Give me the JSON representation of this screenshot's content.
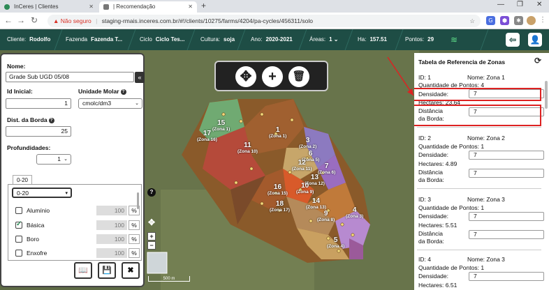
{
  "browser": {
    "tabs": [
      {
        "title": "InCeres | Clientes",
        "active": false
      },
      {
        "title": "| Recomendação",
        "active": true
      }
    ],
    "security_label": "Não seguro",
    "url": "staging-rmais.inceres.com.br/#!/clients/10275/farms/4204/pa-cycles/456311/solo"
  },
  "header": {
    "cliente_label": "Cliente:",
    "cliente_value": "Rodolfo",
    "fazenda_label": "Fazenda",
    "fazenda_value": "Fazenda T...",
    "ciclo_label": "Ciclo",
    "ciclo_value": "Ciclo Tes...",
    "cultura_label": "Cultura:",
    "cultura_value": "soja",
    "ano_label": "Ano:",
    "ano_value": "2020-2021",
    "areas_label": "Áreas:",
    "areas_value": "1",
    "ha_label": "Ha:",
    "ha_value": "157.51",
    "pontos_label": "Pontos:",
    "pontos_value": "29"
  },
  "left_panel": {
    "nome_label": "Nome:",
    "nome_value": "Grade Sub UGD 05/08",
    "id_inicial_label": "Id Inicial:",
    "id_inicial_value": "1",
    "unidade_label": "Unidade Molar",
    "unidade_value": "cmolc/dm3",
    "dist_borda_label": "Dist. da Borda",
    "dist_borda_value": "25",
    "profundidades_label": "Profundidades:",
    "profundidades_value": "1",
    "depth_tab": "0-20",
    "depth_select": "0-20",
    "elements": [
      {
        "name": "Alumínio",
        "checked": false,
        "value": "100",
        "unit": "%"
      },
      {
        "name": "Básica",
        "checked": true,
        "value": "100",
        "unit": "%"
      },
      {
        "name": "Boro",
        "checked": false,
        "value": "100",
        "unit": "%"
      },
      {
        "name": "Enxofre",
        "checked": false,
        "value": "100",
        "unit": "%"
      }
    ]
  },
  "map": {
    "scale_label": "500 m",
    "zones": [
      {
        "n": "15",
        "s": "(Zona 1)"
      },
      {
        "n": "17",
        "s": "(Zona 16)"
      },
      {
        "n": "1",
        "s": "(Zona 1)"
      },
      {
        "n": "11",
        "s": "(Zona 10)"
      },
      {
        "n": "3",
        "s": "(Zona 2)"
      },
      {
        "n": "6",
        "s": "(Zona 5)"
      },
      {
        "n": "12",
        "s": "(Zona 11)"
      },
      {
        "n": "7",
        "s": "(Zona 6)"
      },
      {
        "n": "13",
        "s": "(Zona 12)"
      },
      {
        "n": "16",
        "s": "(Zona 15)"
      },
      {
        "n": "10",
        "s": "(Zona 9)"
      },
      {
        "n": "18",
        "s": "(Zona 17)"
      },
      {
        "n": "14",
        "s": "(Zona 13)"
      },
      {
        "n": "9",
        "s": "(Zona 8)"
      },
      {
        "n": "4",
        "s": "(Zona 3)"
      },
      {
        "n": "5",
        "s": "(Zona 4)"
      }
    ]
  },
  "zone_table": {
    "title": "Tabela de Referencia de Zonas",
    "id_prefix": "ID:",
    "name_prefix": "Nome:",
    "points_label": "Quantidade de Pontos:",
    "density_label": "Densidade:",
    "hectares_label": "Hectares:",
    "distance_label_1": "Distância",
    "distance_label_2": "da Borda:",
    "zones": [
      {
        "id": "1",
        "name": "Zona 1",
        "points": "4",
        "density": "7",
        "hectares": "23.64",
        "distance": "7"
      },
      {
        "id": "2",
        "name": "Zona 2",
        "points": "1",
        "density": "7",
        "hectares": "4.89",
        "distance": "7"
      },
      {
        "id": "3",
        "name": "Zona 3",
        "points": "1",
        "density": "7",
        "hectares": "5.51",
        "distance": "7"
      },
      {
        "id": "4",
        "name": "Zona 3",
        "points": "1",
        "density": "7",
        "hectares": "6.51",
        "distance": "7"
      }
    ]
  }
}
